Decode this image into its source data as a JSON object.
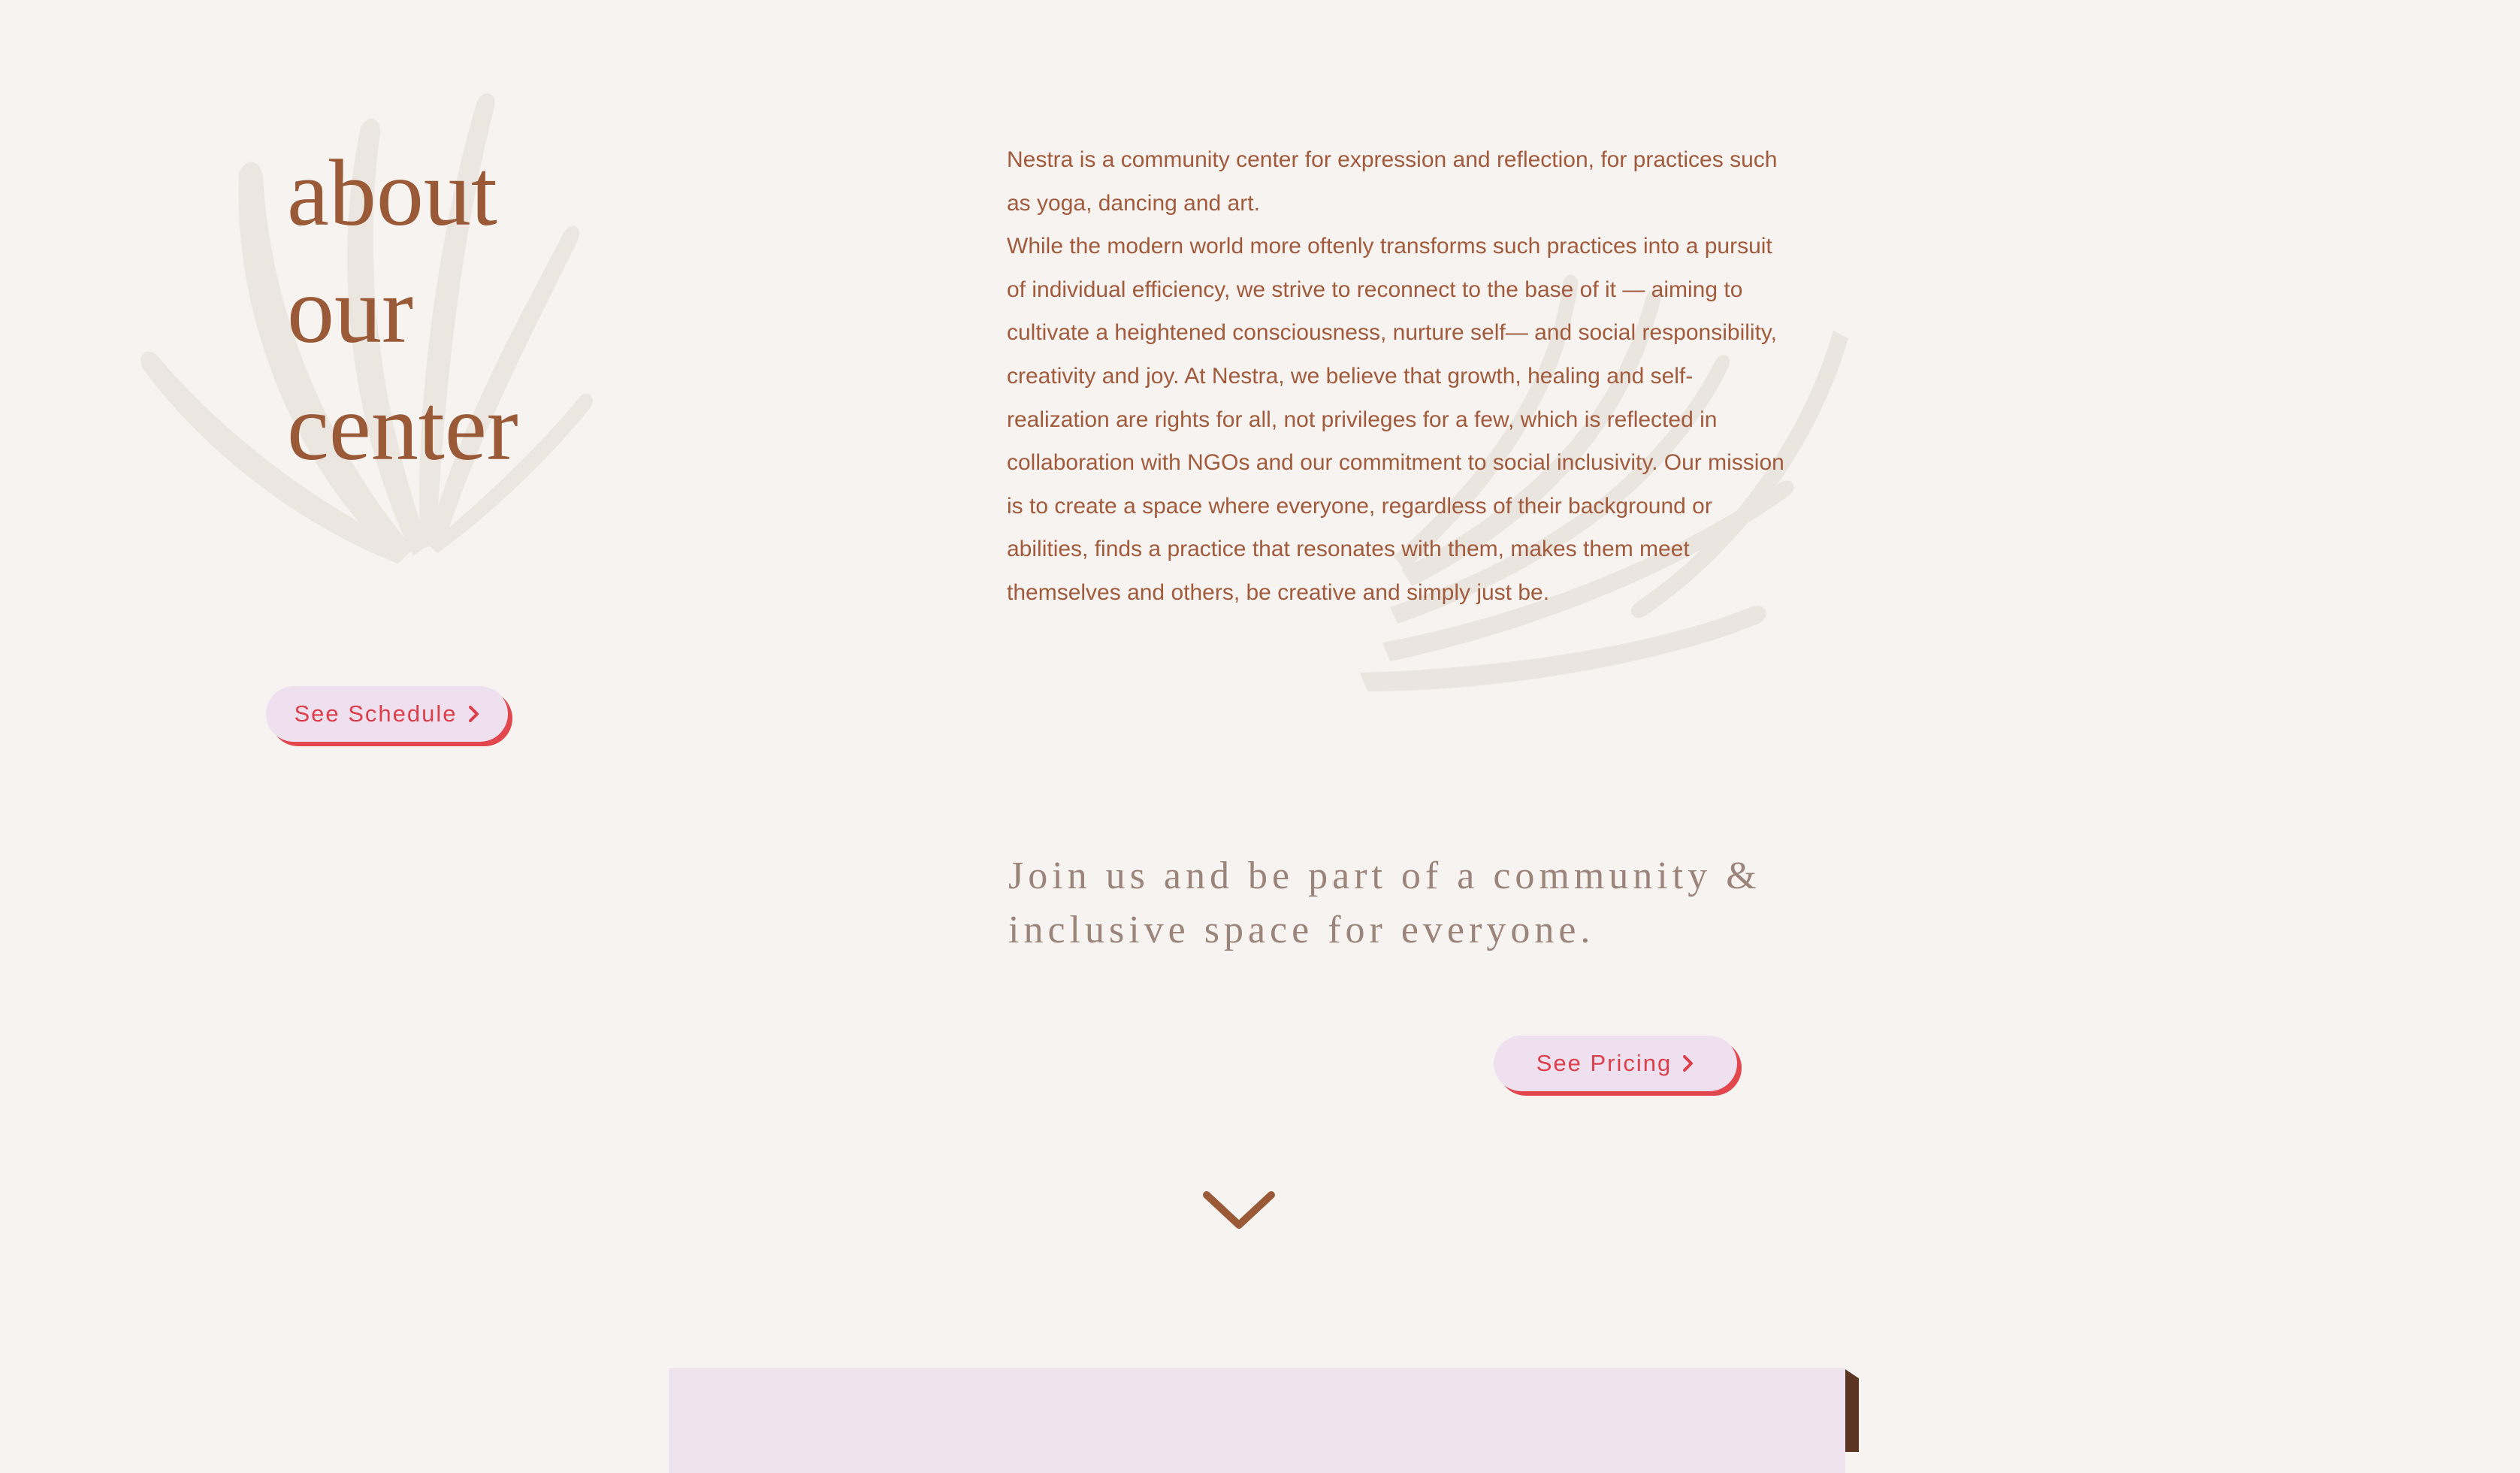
{
  "about": {
    "heading_lines": [
      "about",
      "our",
      "center"
    ]
  },
  "intro": {
    "paragraph_1": "Nestra is a community center for expression and reflection, for practices such as yoga, dancing and art.",
    "paragraph_2": "While the modern world more oftenly transforms such practices into a pursuit of individual efficiency, we strive to reconnect to the base of it — aiming to cultivate a heightened consciousness, nurture self— and social responsibility, creativity and joy. At Nestra, we believe that growth, healing and self-realization are rights for all, not privileges for a few, which is reflected in collaboration with NGOs and our commitment to social inclusivity. Our mission is to create a space where everyone, regardless of their background or abilities, finds a practice that resonates with them, makes them meet themselves and others, be creative and simply just be."
  },
  "buttons": {
    "schedule_label": "See Schedule",
    "pricing_label": "See Pricing"
  },
  "tagline": {
    "text": "Join us and be part of a community & inclusive space for everyone."
  },
  "icons": {
    "chevron_right": "chevron-right-icon",
    "scroll_down": "chevron-down-icon",
    "leaf_decoration": "palm-leaf-icon"
  },
  "colors": {
    "background": "#f7f3f0",
    "heading": "#9a5a37",
    "body_text": "#a15b3c",
    "tagline": "#9b857b",
    "button_bg": "#efe0ef",
    "button_text": "#dc3f4a",
    "button_shadow": "#e2474d",
    "leaf": "#ebe5e0",
    "card_bg": "#efe2ef"
  }
}
